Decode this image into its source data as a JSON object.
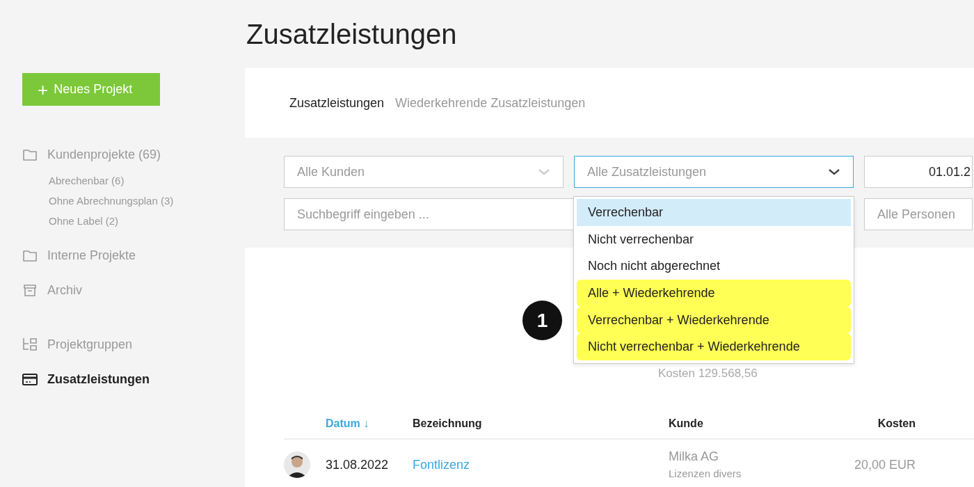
{
  "page_title": "Zusatzleistungen",
  "new_project_button": {
    "label": "Neues Projekt",
    "icon": "+"
  },
  "sidebar": {
    "items": [
      {
        "label": "Kundenprojekte (69)",
        "kind": "folder",
        "selected": false,
        "children": [
          {
            "label": "Abrechenbar (6)"
          },
          {
            "label": "Ohne Abrechnungsplan (3)"
          },
          {
            "label": "Ohne Label (2)"
          }
        ]
      },
      {
        "label": "Interne Projekte",
        "kind": "folder",
        "selected": false
      },
      {
        "label": "Archiv",
        "kind": "archive",
        "selected": false
      },
      {
        "label": "Projektgruppen",
        "kind": "groups",
        "selected": false
      },
      {
        "label": "Zusatzleistungen",
        "kind": "card",
        "selected": true
      }
    ]
  },
  "tabs": [
    {
      "label": "Zusatzleistungen",
      "selected": true
    },
    {
      "label": "Wiederkehrende Zusatzleistungen",
      "selected": false
    }
  ],
  "filters": {
    "customer": {
      "placeholder": "Alle Kunden"
    },
    "services": {
      "placeholder": "Alle Zusatzleistungen",
      "expanded": true
    },
    "date": {
      "value": "01.01.2"
    },
    "search": {
      "placeholder": "Suchbegriff eingeben ..."
    },
    "persons": {
      "placeholder": "Alle Personen"
    }
  },
  "dropdown_options": [
    {
      "label": "Verrechenbar",
      "selected": true,
      "highlighted": false
    },
    {
      "label": "Nicht verrechenbar",
      "selected": false,
      "highlighted": false
    },
    {
      "label": "Noch nicht abgerechnet",
      "selected": false,
      "highlighted": false
    },
    {
      "label": "Alle + Wiederkehrende",
      "selected": false,
      "highlighted": true
    },
    {
      "label": "Verrechenbar + Wiederkehrende",
      "selected": false,
      "highlighted": true
    },
    {
      "label": "Nicht verrechenbar + Wiederkehrende",
      "selected": false,
      "highlighted": true
    }
  ],
  "annotation_marker": "1",
  "summary": "Kosten 129.568,56",
  "table": {
    "columns": [
      {
        "label": "Datum",
        "sorted": true,
        "sort_arrow": "↓"
      },
      {
        "label": "Bezeichnung",
        "sorted": false
      },
      {
        "label": "Kunde",
        "sorted": false
      },
      {
        "label": "Kosten",
        "sorted": false
      }
    ],
    "rows": [
      {
        "date": "31.08.2022",
        "name": "Fontlizenz",
        "customer": "Milka AG",
        "customer_note": "Lizenzen divers",
        "cost": "20,00 EUR"
      }
    ]
  }
}
